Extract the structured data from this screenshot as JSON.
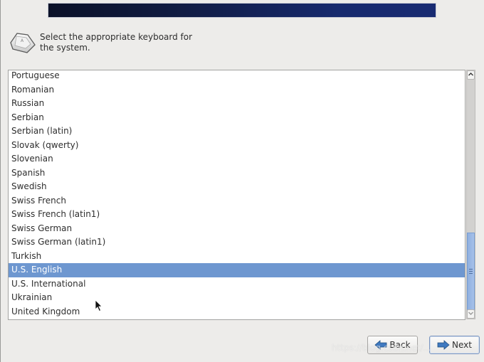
{
  "prompt": {
    "line1": "Select the appropriate keyboard for",
    "line2": "the system."
  },
  "keyboard_list": {
    "items": [
      "Portuguese",
      "Romanian",
      "Russian",
      "Serbian",
      "Serbian (latin)",
      "Slovak (qwerty)",
      "Slovenian",
      "Spanish",
      "Swedish",
      "Swiss French",
      "Swiss French (latin1)",
      "Swiss German",
      "Swiss German (latin1)",
      "Turkish",
      "U.S. English",
      "U.S. International",
      "Ukrainian",
      "United Kingdom"
    ],
    "selected": "U.S. English"
  },
  "scrollbar": {
    "position_percent": 85
  },
  "buttons": {
    "back": "Back",
    "next": "Next"
  },
  "icons": {
    "prompt": "keyboard-key-icon",
    "back": "arrow-left-icon",
    "next": "arrow-right-icon"
  },
  "colors": {
    "selection": "#6e97d0",
    "header_start": "#0b1128",
    "header_end": "#182b72"
  },
  "watermark": "https://blog.csdn.net/..."
}
